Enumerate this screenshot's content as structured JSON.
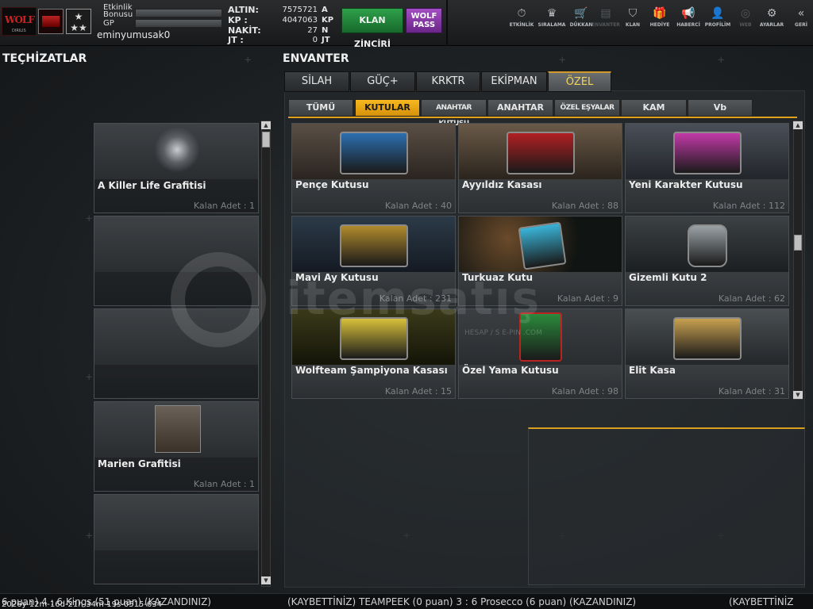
{
  "topbar": {
    "logo_text": "WOLF",
    "logo_sub": "DIRILIS",
    "rank_icon": "stars-rank-icon",
    "event_bonus_label_1": "Etkinlik",
    "event_bonus_label_2": "Bonusu",
    "gp_label": "GP",
    "username": "eminyumusak0",
    "currencies": [
      {
        "label": "ALTIN:",
        "value": "7575721",
        "unit": "A"
      },
      {
        "label": "KP  :",
        "value": "4047063",
        "unit": "KP"
      },
      {
        "label": "NAKİT:",
        "value": "27",
        "unit": "N"
      },
      {
        "label": "JT  :",
        "value": "0",
        "unit": "JT"
      }
    ],
    "clan_chain_label": "KLAN ZİNCİRİ",
    "wolf_pass_label": "WOLF PASS",
    "nav": [
      {
        "icon": "stopwatch-icon",
        "glyph": "⏱",
        "label": "ETKİNLİK"
      },
      {
        "icon": "medal-icon",
        "glyph": "♛",
        "label": "SIRALAMA"
      },
      {
        "icon": "cart-icon",
        "glyph": "🛒",
        "label": "DÜKKAN"
      },
      {
        "icon": "inventory-icon",
        "glyph": "▤",
        "label": "ENVANTER"
      },
      {
        "icon": "shield-icon",
        "glyph": "⛉",
        "label": "KLAN"
      },
      {
        "icon": "gift-icon",
        "glyph": "🎁",
        "label": "HEDİYE"
      },
      {
        "icon": "megaphone-icon",
        "glyph": "📢",
        "label": "HABERCİ"
      },
      {
        "icon": "profile-icon",
        "glyph": "👤",
        "label": "PROFİLİM"
      },
      {
        "icon": "globe-icon",
        "glyph": "◎",
        "label": "WEB"
      },
      {
        "icon": "gear-icon",
        "glyph": "⚙",
        "label": "AYARLAR"
      },
      {
        "icon": "back-icon",
        "glyph": "«",
        "label": "GERİ"
      }
    ]
  },
  "left": {
    "title": "TEÇHİZATLAR",
    "cards": [
      {
        "name": "A Killer Life Grafitisi",
        "qty": "Kalan Adet : 1"
      },
      {
        "name": "",
        "qty": ""
      },
      {
        "name": "",
        "qty": ""
      },
      {
        "name": "Marien Grafitisi",
        "qty": "Kalan Adet : 1"
      },
      {
        "name": "",
        "qty": ""
      }
    ]
  },
  "inventory": {
    "title": "ENVANTER",
    "tabs": [
      "SİLAH",
      "GÜÇ+",
      "KRKTR",
      "EKİPMAN",
      "ÖZEL"
    ],
    "active_tab": "ÖZEL",
    "subtabs": [
      "TÜMÜ",
      "KUTULAR",
      "ANAHTAR KUTUSU",
      "ANAHTAR",
      "ÖZEL EŞYALAR",
      "KAM",
      "Vb"
    ],
    "active_subtab": "KUTULAR",
    "items": [
      {
        "name": "Pençe Kutusu",
        "qty": "Kalan Adet : 40",
        "color": "#2c6fb0"
      },
      {
        "name": "Ayyıldız Kasası",
        "qty": "Kalan Adet : 88",
        "color": "#b01f22"
      },
      {
        "name": "Yeni Karakter Kutusu",
        "qty": "Kalan Adet : 112",
        "color": "#c23aa8"
      },
      {
        "name": "Mavi Ay Kutusu",
        "qty": "Kalan Adet : 231",
        "color": "#b08a2c"
      },
      {
        "name": "Turkuaz Kutu",
        "qty": "Kalan Adet : 9",
        "color": "#3ab4d8"
      },
      {
        "name": "Gizemli Kutu 2",
        "qty": "Kalan Adet : 62",
        "color": "#9aa2a6"
      },
      {
        "name": "Wolfteam Şampiyona Kasası",
        "qty": "Kalan Adet : 15",
        "color": "#d8c03a"
      },
      {
        "name": "Özel Yama Kutusu",
        "qty": "Kalan Adet : 98",
        "color": "#2a8a3c"
      },
      {
        "name": "Elit Kasa",
        "qty": "Kalan Adet : 31",
        "color": "#c8a050"
      }
    ]
  },
  "watermark": {
    "text": "itemsatış",
    "sub": "HESAP / S      E-PIN .COM"
  },
  "ticker": {
    "stamp": "2026y-12m-16d-21h-34m-19s-0515-634",
    "segments": [
      "6 puan) 4 : 6 Kings (51 puan) (KAZANDINIZ)",
      "(KAYBETTİNİZ) TEAMPEEK (0 puan) 3 : 6 Prosecco (6 puan) (KAZANDINIZ)",
      "(KAYBETTİNİZ"
    ]
  }
}
